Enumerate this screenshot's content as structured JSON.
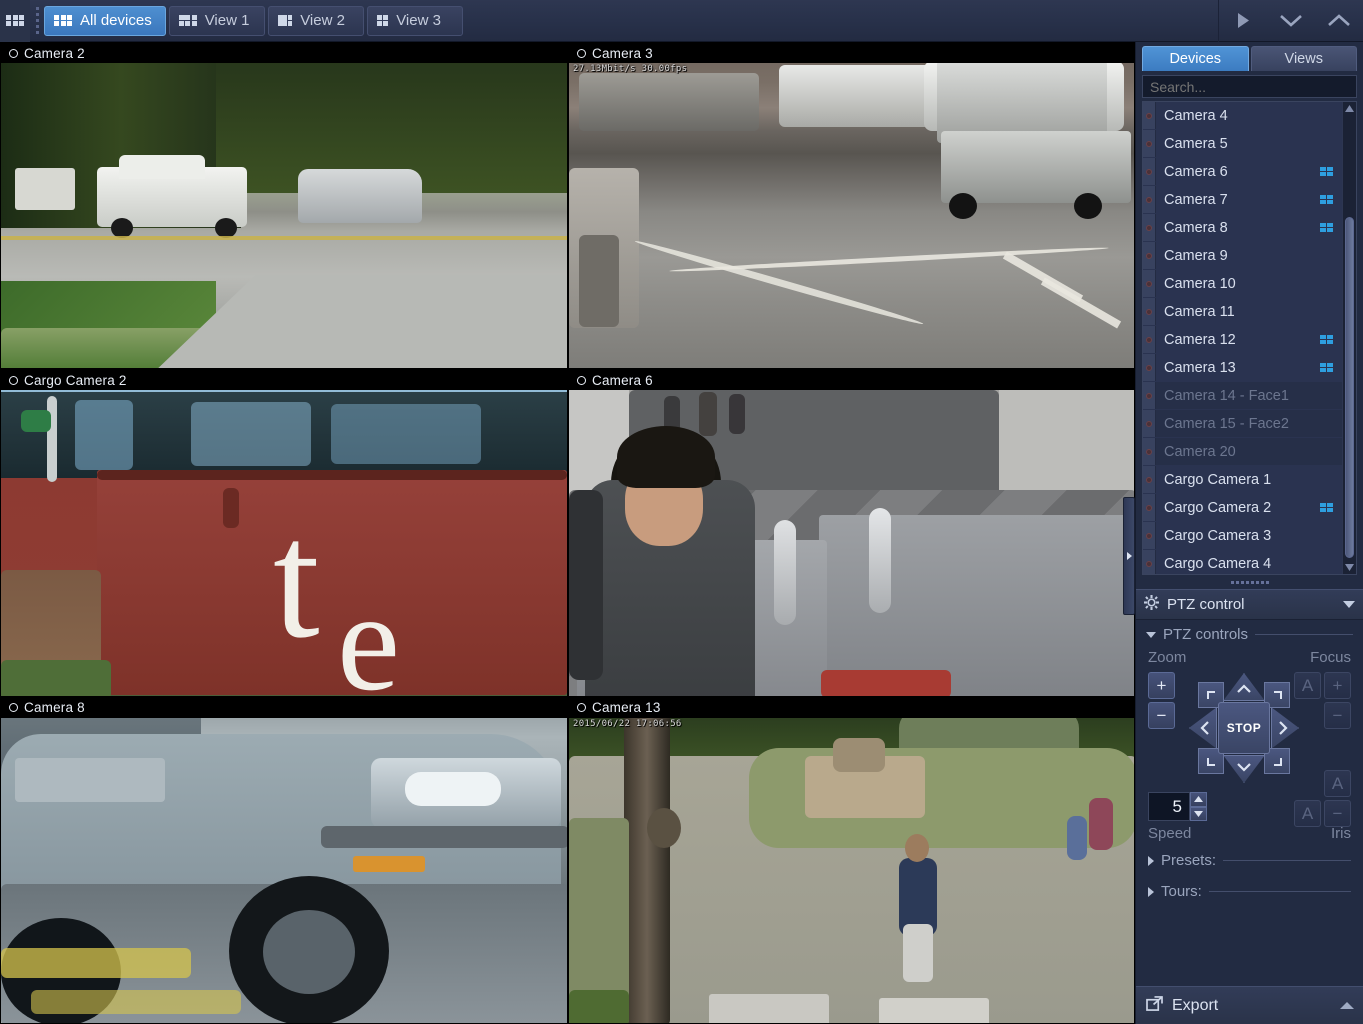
{
  "toolbar": {
    "left_icon": "layout-grid-icon",
    "drag_handle": "toolbar-drag-handle",
    "tabs": [
      {
        "label": "All devices",
        "icon": "grid-3x2-icon",
        "active": true
      },
      {
        "label": "View 1",
        "icon": "layout-view1-icon",
        "active": false
      },
      {
        "label": "View 2",
        "icon": "layout-view2-icon",
        "active": false
      },
      {
        "label": "View 3",
        "icon": "layout-view3-icon",
        "active": false
      }
    ],
    "right_buttons": [
      {
        "name": "play-button",
        "glyph": "▶"
      },
      {
        "name": "chevron-down-button",
        "glyph": "∨"
      },
      {
        "name": "chevron-up-button",
        "glyph": "∧"
      }
    ]
  },
  "video_grid": {
    "rows": 3,
    "cols": 2,
    "tiles": [
      {
        "title": "Camera 2",
        "osd": "",
        "selected": true,
        "scene": "s-cam2"
      },
      {
        "title": "Camera 3",
        "osd": "27.13Mbit/s 30.00fps",
        "selected": false,
        "scene": "s-cam3"
      },
      {
        "title": "Cargo Camera 2",
        "osd": "",
        "selected": false,
        "scene": "s-cargo2"
      },
      {
        "title": "Camera 6",
        "osd": "",
        "selected": false,
        "scene": "s-cam6"
      },
      {
        "title": "Camera 8",
        "osd": "",
        "selected": false,
        "scene": "s-cam8"
      },
      {
        "title": "Camera 13",
        "osd": "2015/06/22 17:06:56",
        "selected": false,
        "scene": "s-cam13"
      }
    ]
  },
  "sidebar": {
    "tabs": [
      {
        "label": "Devices",
        "active": true
      },
      {
        "label": "Views",
        "active": false
      }
    ],
    "search": {
      "placeholder": "Search...",
      "value": ""
    },
    "devices": [
      {
        "label": "Camera 4",
        "has_layout_icon": false,
        "disabled": false
      },
      {
        "label": "Camera 5",
        "has_layout_icon": false,
        "disabled": false
      },
      {
        "label": "Camera 6",
        "has_layout_icon": true,
        "disabled": false
      },
      {
        "label": "Camera 7",
        "has_layout_icon": true,
        "disabled": false
      },
      {
        "label": "Camera 8",
        "has_layout_icon": true,
        "disabled": false
      },
      {
        "label": "Camera 9",
        "has_layout_icon": false,
        "disabled": false
      },
      {
        "label": "Camera 10",
        "has_layout_icon": false,
        "disabled": false
      },
      {
        "label": "Camera 11",
        "has_layout_icon": false,
        "disabled": false
      },
      {
        "label": "Camera 12",
        "has_layout_icon": true,
        "disabled": false
      },
      {
        "label": "Camera 13",
        "has_layout_icon": true,
        "disabled": false
      },
      {
        "label": "Camera 14 - Face1",
        "has_layout_icon": false,
        "disabled": true
      },
      {
        "label": "Camera 15 - Face2",
        "has_layout_icon": false,
        "disabled": true
      },
      {
        "label": "Camera 20",
        "has_layout_icon": false,
        "disabled": true
      },
      {
        "label": "Cargo Camera 1",
        "has_layout_icon": false,
        "disabled": false
      },
      {
        "label": "Cargo Camera 2",
        "has_layout_icon": true,
        "disabled": false
      },
      {
        "label": "Cargo Camera 3",
        "has_layout_icon": false,
        "disabled": false
      },
      {
        "label": "Cargo Camera 4",
        "has_layout_icon": false,
        "disabled": false
      }
    ]
  },
  "ptz": {
    "panel_title": "PTZ control",
    "panel_icon": "ptz-gear-icon",
    "section_label": "PTZ controls",
    "zoom_label": "Zoom",
    "focus_label": "Focus",
    "zoom_in": "+",
    "zoom_out": "−",
    "focus_auto": "A",
    "focus_in": "+",
    "focus_out": "−",
    "stop_label": "STOP",
    "speed_value": "5",
    "speed_label": "Speed",
    "iris_label": "Iris",
    "iris_auto": "A",
    "iris_open": "A",
    "iris_close": "−",
    "presets_label": "Presets:",
    "tours_label": "Tours:"
  },
  "export": {
    "label": "Export",
    "icon": "export-icon"
  },
  "colors": {
    "accent": "#4a8dd0",
    "accent_tab": "#3c7cc1",
    "layout_icon": "#2e9fe0",
    "panel_bg": "#222b42",
    "toolbar_bg": "#2a3349",
    "list_bg": "#2a3350"
  }
}
